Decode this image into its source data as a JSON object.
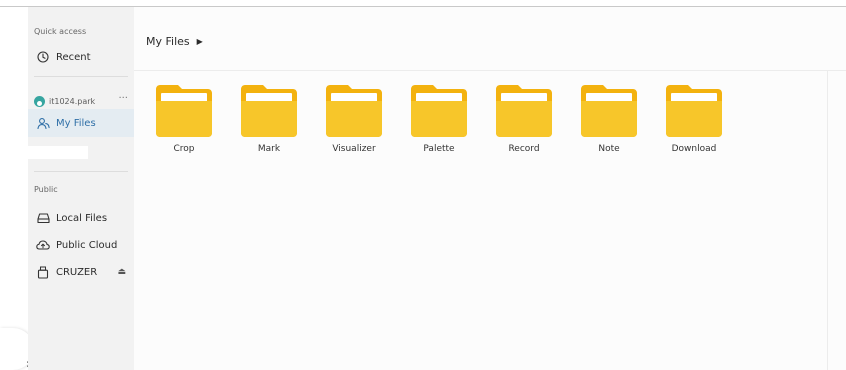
{
  "colors": {
    "accent": "#2f6fa7",
    "sidebar_bg": "#f2f2f2",
    "selected_bg": "#e4ecf2",
    "folder_yellow": "#f6c11c",
    "avatar": "#37a5a0"
  },
  "sidebar": {
    "quick_access_label": "Quick access",
    "recent_label": "Recent",
    "recent_icon": "clock-icon",
    "user_name": "it1024.park",
    "more_label": "···",
    "my_files_label": "My Files",
    "my_files_icon": "users-icon",
    "public_label": "Public",
    "items": [
      {
        "label": "Local Files",
        "icon": "drive-icon"
      },
      {
        "label": "Public Cloud",
        "icon": "cloud-icon"
      },
      {
        "label": "CRUZER",
        "icon": "usb-icon"
      }
    ],
    "eject_label": "⏏"
  },
  "main": {
    "breadcrumb": "My Files",
    "breadcrumb_arrow": "▶",
    "folders": [
      {
        "label": "Crop"
      },
      {
        "label": "Mark"
      },
      {
        "label": "Visualizer"
      },
      {
        "label": "Palette"
      },
      {
        "label": "Record"
      },
      {
        "label": "Note"
      },
      {
        "label": "Download"
      }
    ]
  },
  "left_tab_chevron": "›"
}
